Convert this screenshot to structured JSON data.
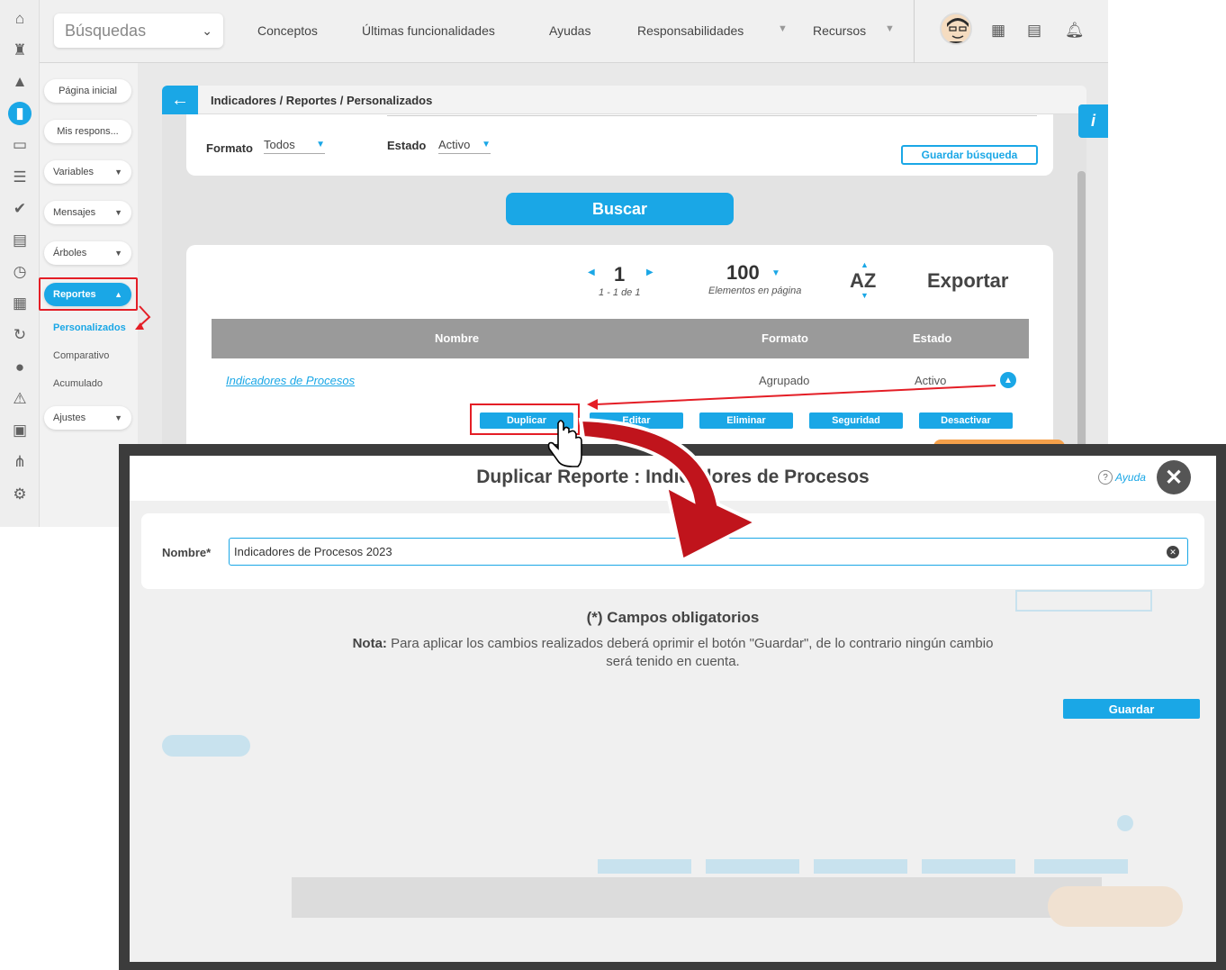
{
  "topbar": {
    "search_select": "Búsquedas",
    "nav": [
      "Conceptos",
      "Últimas funcionalidades",
      "Ayudas",
      "Responsabilidades",
      "Recursos"
    ]
  },
  "icons": {
    "left_bar": [
      "home-icon",
      "chess-icon",
      "triangle-icon",
      "chart-icon",
      "monitor-icon",
      "list-icon",
      "check-circle-icon",
      "book-icon",
      "clock-icon",
      "document-icon",
      "refresh-icon",
      "circle-icon",
      "alert-icon",
      "calendar-icon",
      "network-icon",
      "gear-icon"
    ]
  },
  "sidebar": {
    "home": "Página inicial",
    "resp": "Mis respons...",
    "variables": "Variables",
    "mensajes": "Mensajes",
    "arboles": "Árboles",
    "reportes": "Reportes",
    "sub": [
      "Personalizados",
      "Comparativo",
      "Acumulado"
    ],
    "ajustes": "Ajustes"
  },
  "panel": {
    "breadcrumb": "Indicadores / Reportes / Personalizados",
    "formato_label": "Formato",
    "formato_value": "Todos",
    "estado_label": "Estado",
    "estado_value": "Activo",
    "save_search": "Guardar búsqueda",
    "buscar": "Buscar"
  },
  "results": {
    "page": "1",
    "page_range": "1 - 1 de 1",
    "per_page": "100",
    "per_page_label": "Elementos en página",
    "sort": "AZ",
    "export": "Exportar",
    "headers": [
      "Nombre",
      "Formato",
      "Estado"
    ],
    "row": {
      "name": "Indicadores de Procesos",
      "format": "Agrupado",
      "status": "Activo"
    },
    "actions": [
      "Duplicar",
      "Editar",
      "Eliminar",
      "Seguridad",
      "Desactivar"
    ]
  },
  "modal": {
    "title": "Duplicar Reporte : Indicadores de Procesos",
    "help": "Ayuda",
    "name_label": "Nombre*",
    "name_value": "Indicadores de Procesos 2023",
    "required_note": "(*) Campos obligatorios",
    "note_label": "Nota:",
    "note_text": "Para aplicar los cambios realizados deberá oprimir el botón \"Guardar\", de lo contrario ningún cambio será tenido en cuenta.",
    "save": "Guardar"
  },
  "colors": {
    "accent": "#1aa7e6",
    "highlight": "#e41e26"
  }
}
